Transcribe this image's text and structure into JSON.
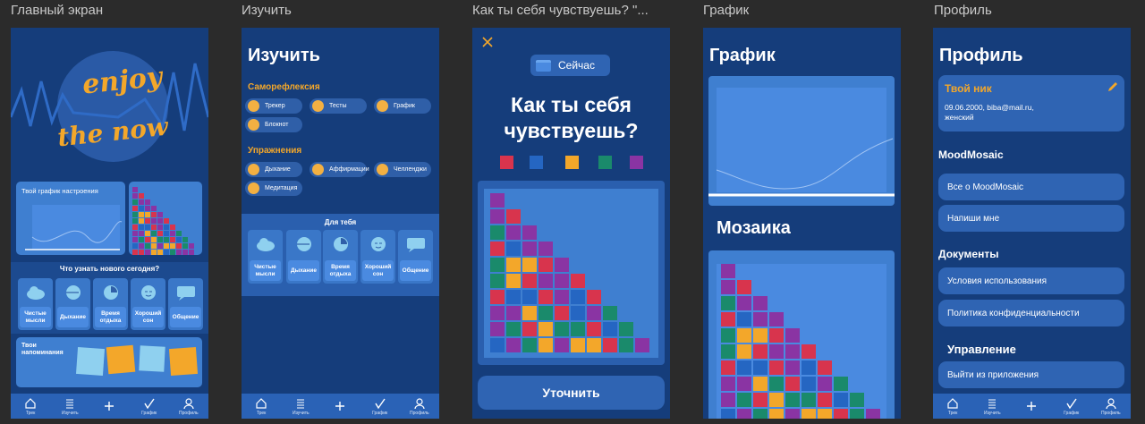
{
  "frame_titles": [
    "Главный экран",
    "Изучить",
    "Как ты себя чувствуешь? \"...",
    "График",
    "Профиль"
  ],
  "colors": {
    "background": "#153d7b",
    "accent": "#f3a72a",
    "button": "#2f64b3",
    "mosaic": [
      "#d8344d",
      "#1a8a6b",
      "#8a34a3",
      "#f3a72a",
      "#2566c2"
    ]
  },
  "tabbar": {
    "items": [
      "Трек",
      "Изучить",
      "",
      "График",
      "Профиль"
    ]
  },
  "home": {
    "hero_line1": "enjoy",
    "hero_line2": "the now",
    "mood_chart_title": "Твой график настроения",
    "what_new": "Что узнать нового сегодня?",
    "tiles": [
      "Чистые мысли",
      "Дыхание",
      "Время отдыха",
      "Хороший сон",
      "Общение"
    ],
    "reminders_title": "Твои напоминания"
  },
  "learn": {
    "title": "Изучить",
    "section1": "Саморефлексия",
    "section1_items": [
      "Трекер",
      "Тесты",
      "График",
      "Блокнот"
    ],
    "section2": "Упражнения",
    "section2_items": [
      "Дыхание",
      "Аффирмации",
      "Челленджи",
      "Медитация"
    ],
    "for_you": "Для тебя",
    "tiles": [
      "Чистые мысли",
      "Дыхание",
      "Время отдыха",
      "Хороший сон",
      "Общение"
    ]
  },
  "feel": {
    "now_label": "Сейчас",
    "question": "Как ты себя чувствуешь?",
    "refine_button": "Уточнить"
  },
  "chart": {
    "title": "График",
    "mosaic_title": "Мозаика"
  },
  "profile": {
    "title": "Профиль",
    "nick": "Твой ник",
    "info_line1": "09.06.2000, biba@mail.ru,",
    "info_line2": "женский",
    "sec_app": "MoodMosaic",
    "about": "Все о MoodMosaic",
    "write": "Напиши мне",
    "sec_docs": "Документы",
    "terms": "Условия использования",
    "privacy": "Политика конфиденциальности",
    "sec_manage": "Управление",
    "logout": "Выйти из приложения"
  }
}
